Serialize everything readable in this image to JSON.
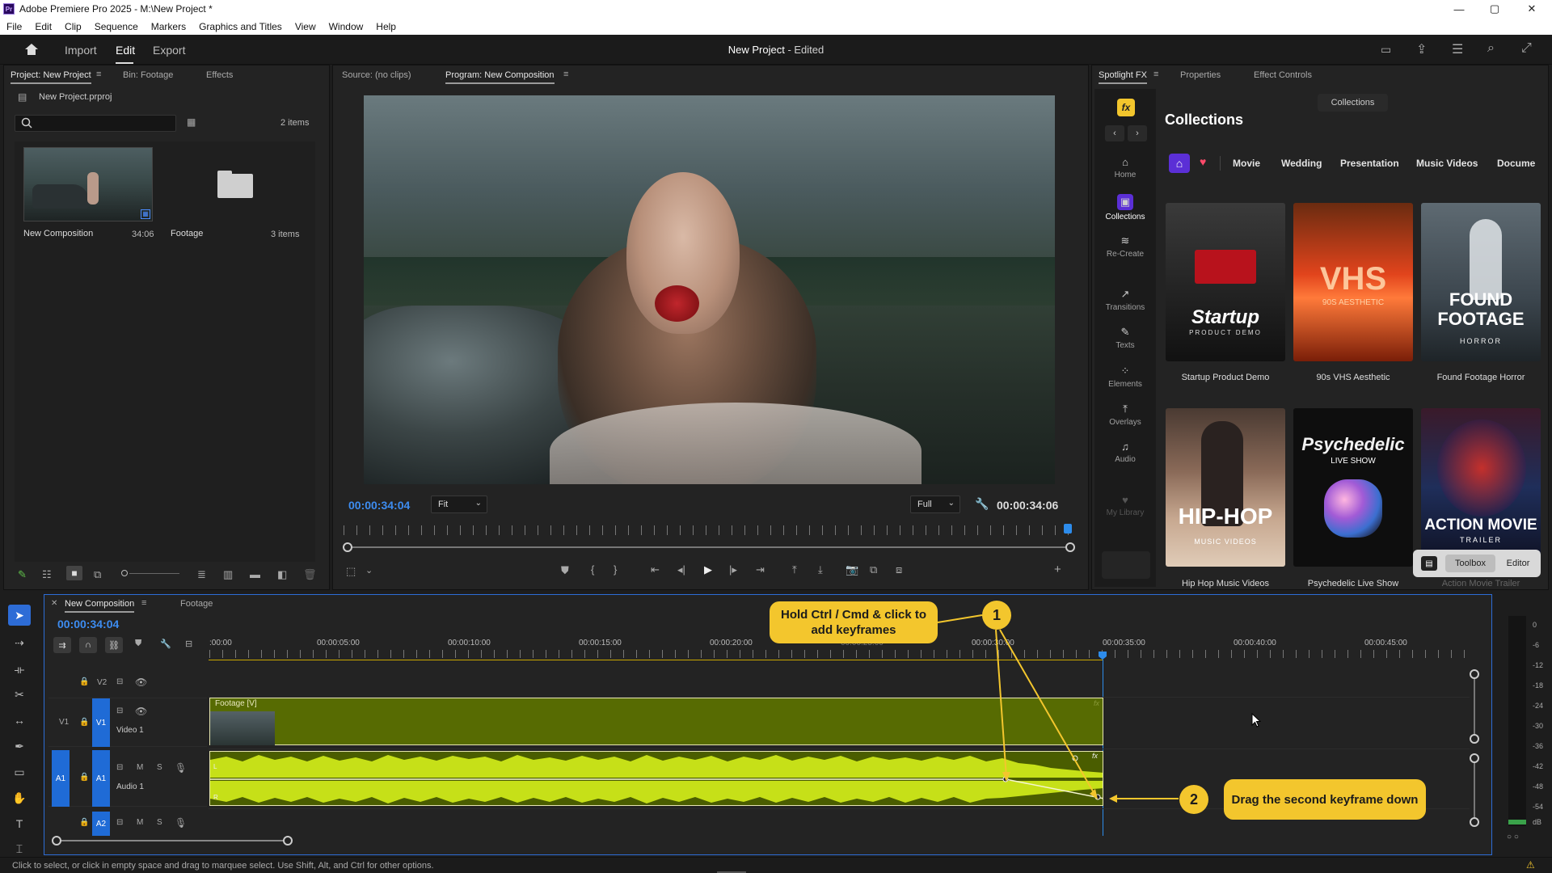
{
  "window": {
    "title": "Adobe Premiere Pro 2025 - M:\\New Project *",
    "min": "—",
    "max": "▢",
    "close": "✕"
  },
  "menu": [
    "File",
    "Edit",
    "Clip",
    "Sequence",
    "Markers",
    "Graphics and Titles",
    "View",
    "Window",
    "Help"
  ],
  "appbar": {
    "import": "Import",
    "edit": "Edit",
    "export": "Export",
    "project_title": "New Project",
    "project_status": "- Edited"
  },
  "project_panel": {
    "tabs": [
      "Project: New Project",
      "Bin: Footage",
      "Effects"
    ],
    "file_name": "New Project.prproj",
    "item_count": "2 items",
    "items": [
      {
        "name": "New Composition",
        "meta": "34:06"
      },
      {
        "name": "Footage",
        "meta": "3 items"
      }
    ]
  },
  "monitor": {
    "source_tab": "Source: (no clips)",
    "program_tab": "Program: New Composition",
    "timecode_current": "00:00:34:04",
    "timecode_end": "00:00:34:06",
    "fit": "Fit",
    "quality": "Full"
  },
  "right_panel": {
    "tabs": [
      "Spotlight FX",
      "Properties",
      "Effect Controls"
    ],
    "fx_badge": "fx",
    "collections_btn": "Collections",
    "heading": "Collections",
    "categories": [
      "Movie",
      "Wedding",
      "Presentation",
      "Music Videos",
      "Docume"
    ],
    "sidebar": [
      {
        "glyph": "⌂",
        "label": "Home"
      },
      {
        "glyph": "▣",
        "label": "Collections"
      },
      {
        "glyph": "≋",
        "label": "Re-Create"
      },
      {
        "glyph": "↗",
        "label": "Transitions"
      },
      {
        "glyph": "✎",
        "label": "Texts"
      },
      {
        "glyph": "⁘",
        "label": "Elements"
      },
      {
        "glyph": "⤒",
        "label": "Overlays"
      },
      {
        "glyph": "♫",
        "label": "Audio"
      },
      {
        "glyph": "♥",
        "label": "My Library"
      }
    ],
    "cards": [
      {
        "title": "Startup",
        "sub": "PRODUCT DEMO",
        "caption": "Startup Product Demo",
        "color": "#eeeeee"
      },
      {
        "title": "VHS",
        "sub": "90S AESTHETIC",
        "caption": "90s VHS Aesthetic",
        "color": "#ff5a2a"
      },
      {
        "title": "FOUND FOOTAGE",
        "sub": "HORROR",
        "caption": "Found Footage Horror",
        "color": "#7a8690"
      },
      {
        "title": "HIP-HOP",
        "sub": "MUSIC VIDEOS",
        "caption": "Hip Hop Music Videos",
        "color": "#d9c8b2"
      },
      {
        "title": "Psychedelic",
        "sub": "LIVE SHOW",
        "caption": "Psychedelic Live Show",
        "color": "#111111"
      },
      {
        "title": "ACTION MOVIE",
        "sub": "TRAILER",
        "caption": "Action Movie Trailer",
        "color": "#2a3a6a"
      }
    ],
    "toolbox": "Toolbox",
    "editor": "Editor"
  },
  "timeline": {
    "tab": "New Composition",
    "tab2": "Footage",
    "timecode": "00:00:34:04",
    "ruler": [
      ":00:00",
      "00:00:05:00",
      "00:00:10:00",
      "00:00:15:00",
      "00:00:20:00",
      "00:00:25:00",
      "00:00:30:00",
      "00:00:35:00",
      "00:00:40:00",
      "00:00:45:00"
    ],
    "tracks": {
      "v2": "V2",
      "v1": "V1",
      "v1_name": "Video 1",
      "a1": "A1",
      "a1_name": "Audio 1",
      "a2": "A2",
      "clip_label": "Footage [V]",
      "m": "M",
      "s": "S"
    },
    "meter_labels": [
      "0",
      "-6",
      "-12",
      "-18",
      "-24",
      "-30",
      "-36",
      "-42",
      "-48",
      "-54",
      "dB"
    ]
  },
  "callouts": {
    "one_num": "1",
    "one_text": "Hold Ctrl / Cmd & click to add keyframes",
    "two_num": "2",
    "two_text": "Drag the second keyframe down"
  },
  "statusbar": "Click to select, or click in empty space and drag to marquee select. Use Shift, Alt, and Ctrl for other options.",
  "colors": {
    "accent": "#2d8ceb",
    "highlight": "#f3c62d",
    "clip": "#5a6d00",
    "audio": "#b9d611"
  }
}
